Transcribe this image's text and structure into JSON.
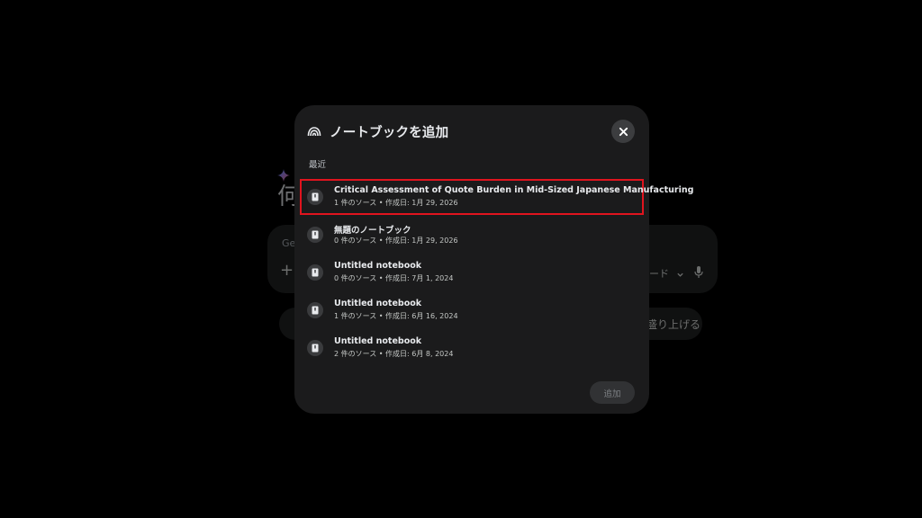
{
  "background": {
    "greeting_fragment": "何",
    "input_placeholder_fragment": "Ge",
    "plus_symbol": "+",
    "mode_fragment": "ード",
    "chip_fragment": "盛り上げる"
  },
  "dialog": {
    "title": "ノートブックを追加",
    "header_icon": "notebooklm-icon",
    "close_icon": "close-icon",
    "section_label": "最近",
    "add_button_label": "追加",
    "notebooks": [
      {
        "title": "Critical Assessment of Quote Burden in Mid-Sized Japanese Manufacturing",
        "meta": "1 件のソース • 作成日: 1月 29, 2026",
        "selected": true
      },
      {
        "title": "無題のノートブック",
        "meta": "0 件のソース • 作成日: 1月 29, 2026",
        "selected": false
      },
      {
        "title": "Untitled notebook",
        "meta": "0 件のソース • 作成日: 7月 1, 2024",
        "selected": false
      },
      {
        "title": "Untitled notebook",
        "meta": "1 件のソース • 作成日: 6月 16, 2024",
        "selected": false
      },
      {
        "title": "Untitled notebook",
        "meta": "2 件のソース • 作成日: 6月 8, 2024",
        "selected": false
      }
    ]
  },
  "colors": {
    "page_bg": "#000000",
    "dialog_bg": "#1b1b1c",
    "selection_border": "#e0141e",
    "text_primary": "#e8eaed",
    "disabled_button_bg": "#313234"
  }
}
